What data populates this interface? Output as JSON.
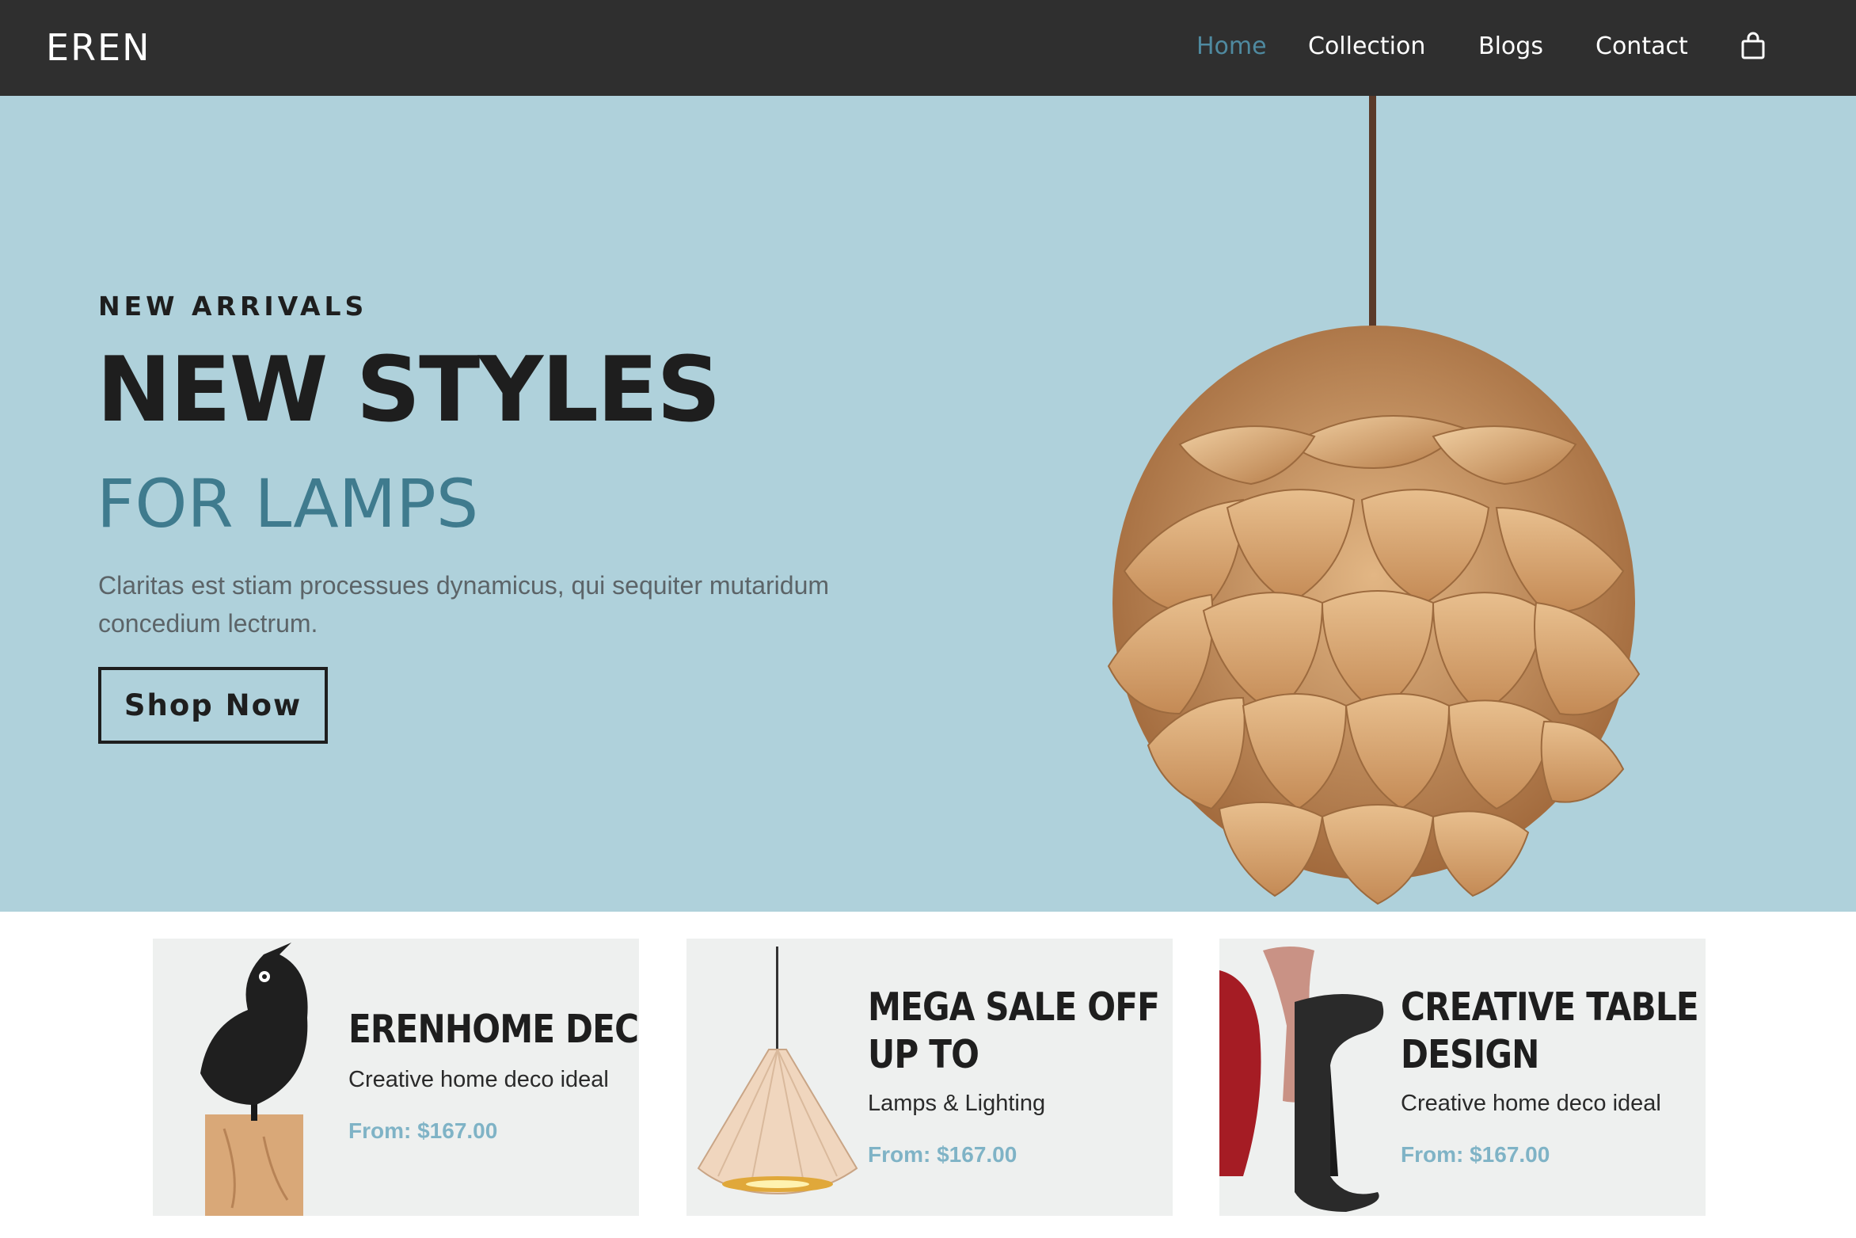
{
  "header": {
    "logo": "EREN",
    "nav": [
      {
        "label": "Home",
        "active": true
      },
      {
        "label": "Collection",
        "active": false
      },
      {
        "label": "Blogs",
        "active": false
      },
      {
        "label": "Contact",
        "active": false
      }
    ],
    "cart_icon": "shopping-bag-icon"
  },
  "hero": {
    "kicker": "NEW ARRIVALS",
    "title": "NEW STYLES",
    "subtitle": "FOR LAMPS",
    "text": "Claritas est stiam processues dynamicus, qui sequiter mutaridum concedium lectrum.",
    "button_label": "Shop Now"
  },
  "cards": [
    {
      "title_line1": "ERENHOME DECO",
      "title_line2": "",
      "subtitle": "Creative home deco ideal",
      "price": "From: $167.00"
    },
    {
      "title_line1": "MEGA SALE OFF",
      "title_line2": "UP TO",
      "subtitle": "Lamps & Lighting",
      "price": "From: $167.00"
    },
    {
      "title_line1": "CREATIVE TABLE",
      "title_line2": "DESIGN",
      "subtitle": "Creative home deco ideal",
      "price": "From: $167.00"
    }
  ],
  "colors": {
    "header_bg": "#2f2f2f",
    "hero_bg": "#afd1db",
    "accent": "#3f7b8e",
    "nav_active": "#4f8aa0",
    "price": "#7fb3c6",
    "card_bg": "#eef0ef"
  }
}
